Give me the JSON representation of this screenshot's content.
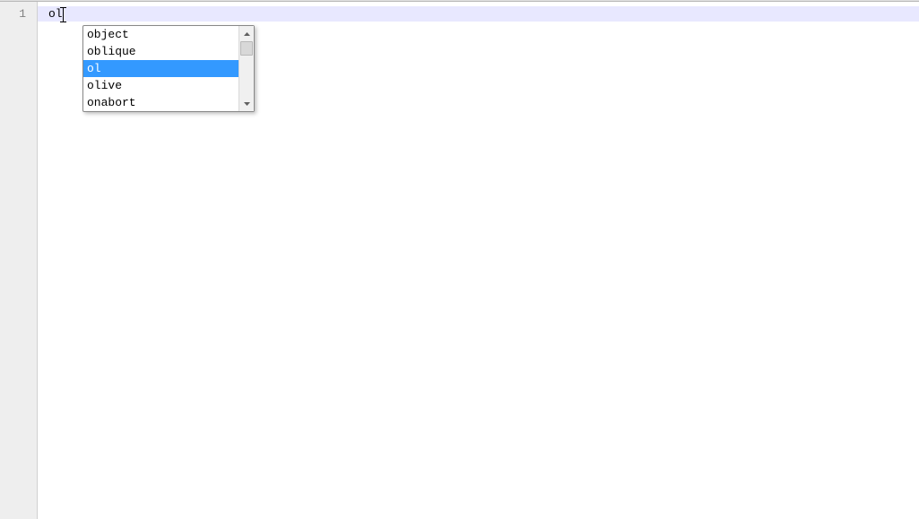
{
  "editor": {
    "line_number": "1",
    "typed_text": "ol"
  },
  "autocomplete": {
    "items": [
      {
        "label": "object",
        "selected": false
      },
      {
        "label": "oblique",
        "selected": false
      },
      {
        "label": "ol",
        "selected": true
      },
      {
        "label": "olive",
        "selected": false
      },
      {
        "label": "onabort",
        "selected": false
      }
    ]
  }
}
